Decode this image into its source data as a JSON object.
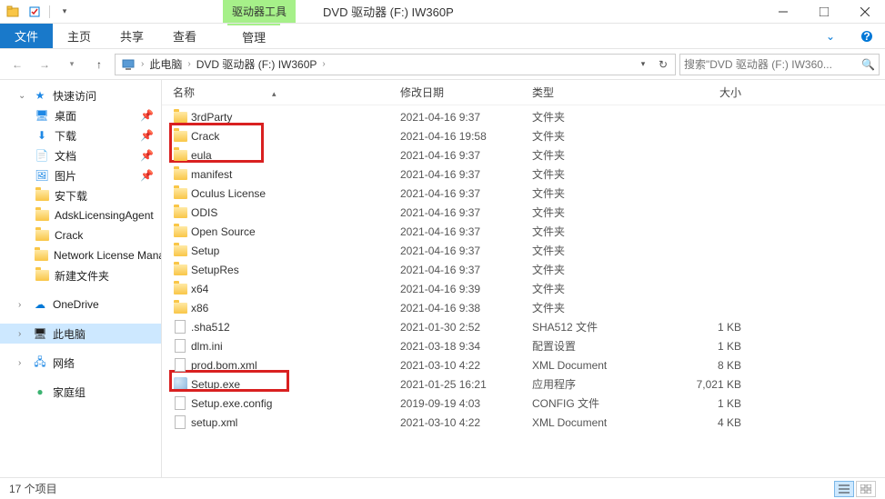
{
  "window": {
    "context_tab": "驱动器工具",
    "title": "DVD 驱动器 (F:) IW360P"
  },
  "ribbon": {
    "file": "文件",
    "tabs": [
      "主页",
      "共享",
      "查看"
    ],
    "context": "管理"
  },
  "address": {
    "crumbs": [
      "此电脑",
      "DVD 驱动器 (F:) IW360P"
    ],
    "search_placeholder": "搜索\"DVD 驱动器 (F:) IW360..."
  },
  "sidebar": {
    "quick_access": "快速访问",
    "quick_items": [
      "桌面",
      "下载",
      "文档",
      "图片",
      "安下载",
      "AdskLicensingAgent",
      "Crack",
      "Network License Manager",
      "新建文件夹"
    ],
    "onedrive": "OneDrive",
    "this_pc": "此电脑",
    "network": "网络",
    "homegroup": "家庭组"
  },
  "columns": {
    "name": "名称",
    "date": "修改日期",
    "type": "类型",
    "size": "大小"
  },
  "files": [
    {
      "name": "3rdParty",
      "date": "2021-04-16 9:37",
      "type": "文件夹",
      "size": "",
      "kind": "folder"
    },
    {
      "name": "Crack",
      "date": "2021-04-16 19:58",
      "type": "文件夹",
      "size": "",
      "kind": "folder"
    },
    {
      "name": "eula",
      "date": "2021-04-16 9:37",
      "type": "文件夹",
      "size": "",
      "kind": "folder"
    },
    {
      "name": "manifest",
      "date": "2021-04-16 9:37",
      "type": "文件夹",
      "size": "",
      "kind": "folder"
    },
    {
      "name": "Oculus License",
      "date": "2021-04-16 9:37",
      "type": "文件夹",
      "size": "",
      "kind": "folder"
    },
    {
      "name": "ODIS",
      "date": "2021-04-16 9:37",
      "type": "文件夹",
      "size": "",
      "kind": "folder"
    },
    {
      "name": "Open Source",
      "date": "2021-04-16 9:37",
      "type": "文件夹",
      "size": "",
      "kind": "folder"
    },
    {
      "name": "Setup",
      "date": "2021-04-16 9:37",
      "type": "文件夹",
      "size": "",
      "kind": "folder"
    },
    {
      "name": "SetupRes",
      "date": "2021-04-16 9:37",
      "type": "文件夹",
      "size": "",
      "kind": "folder"
    },
    {
      "name": "x64",
      "date": "2021-04-16 9:39",
      "type": "文件夹",
      "size": "",
      "kind": "folder"
    },
    {
      "name": "x86",
      "date": "2021-04-16 9:38",
      "type": "文件夹",
      "size": "",
      "kind": "folder"
    },
    {
      "name": ".sha512",
      "date": "2021-01-30 2:52",
      "type": "SHA512 文件",
      "size": "1 KB",
      "kind": "file"
    },
    {
      "name": "dlm.ini",
      "date": "2021-03-18 9:34",
      "type": "配置设置",
      "size": "1 KB",
      "kind": "file"
    },
    {
      "name": "prod.bom.xml",
      "date": "2021-03-10 4:22",
      "type": "XML Document",
      "size": "8 KB",
      "kind": "file"
    },
    {
      "name": "Setup.exe",
      "date": "2021-01-25 16:21",
      "type": "应用程序",
      "size": "7,021 KB",
      "kind": "exe"
    },
    {
      "name": "Setup.exe.config",
      "date": "2019-09-19 4:03",
      "type": "CONFIG 文件",
      "size": "1 KB",
      "kind": "file"
    },
    {
      "name": "setup.xml",
      "date": "2021-03-10 4:22",
      "type": "XML Document",
      "size": "4 KB",
      "kind": "file"
    }
  ],
  "status": {
    "count": "17 个项目"
  }
}
